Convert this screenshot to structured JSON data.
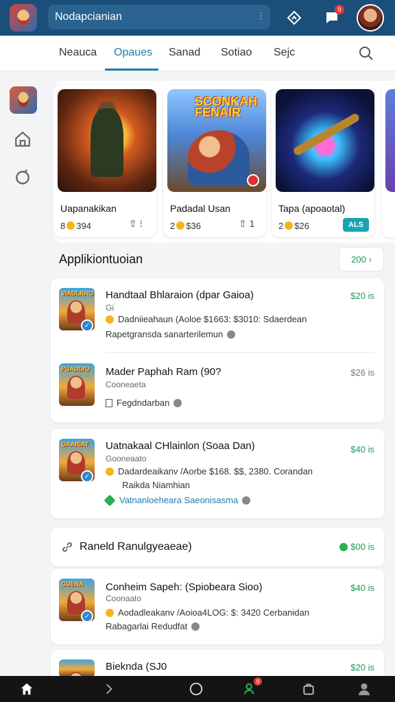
{
  "header": {
    "search_text": "Nodapcianian",
    "mic_glyph": "⫶",
    "notification_count": "9"
  },
  "tabs": [
    {
      "label": "Neauca"
    },
    {
      "label": "Opaues"
    },
    {
      "label": "Sanad"
    },
    {
      "label": "Sotiao"
    },
    {
      "label": "Sejc"
    }
  ],
  "featured": [
    {
      "title": "Uapanakikan",
      "price": "8",
      "price_after": "394",
      "action": "⇧ ⁝"
    },
    {
      "title": "Padadal Usan",
      "price": "2",
      "price_after": "$36",
      "action": "⇧ 1",
      "logo": "SCONKAH FENAIR"
    },
    {
      "title": "Tapa (apoaotal)",
      "price": "2",
      "price_after": "$26",
      "button": "ALS"
    }
  ],
  "section": {
    "title": "Applikiontuoian",
    "pill": "200 ›"
  },
  "list_a": [
    {
      "thumb_label": "VIADLRRO",
      "title": "Handtaal Bhlaraion (dpar Gaioa)",
      "sub": "Gi",
      "meta": "Dadniieahaun (Aoloe $1663: $3010: Sdaerdean",
      "foot": "Rapetgransda sanarterilemun",
      "price": "$20 is"
    },
    {
      "thumb_label": "PUADDIO",
      "title": "Mader Paphah Ram (90?",
      "sub": "Cooneaeta",
      "meta": "",
      "foot": "Fegdndarban",
      "price": "$26 is"
    }
  ],
  "list_b": {
    "thumb_label": "GAARIAT",
    "title": "Uatnakaal CHlainlon (Soaa Dan)",
    "sub": "Gooneaato",
    "meta": "Dadardeaikanv /Aorbe $168. $$, 2380. Corandan",
    "meta2": "Raikda Niamhian",
    "foot": "Vatnanloeheara Saeonisasma",
    "price": "$40 is"
  },
  "related": {
    "title": "Raneld Ranulgyeaeae)",
    "price": "$00 is"
  },
  "list_c": [
    {
      "thumb_label": "GUENA",
      "title": "Conheim Sapeh: (Spiobeara Sioo)",
      "sub": "Coonaato",
      "meta": "Aodadleakanv /Aoioa4LOG: $: 3420 Cerbanidan",
      "foot": "Rabagarlai Redudfat",
      "price": "$40 is"
    },
    {
      "thumb_label": "",
      "title": "Bieknda (SJ0",
      "price": "$20 is"
    }
  ],
  "bottom_nav": {
    "badge": "9"
  }
}
